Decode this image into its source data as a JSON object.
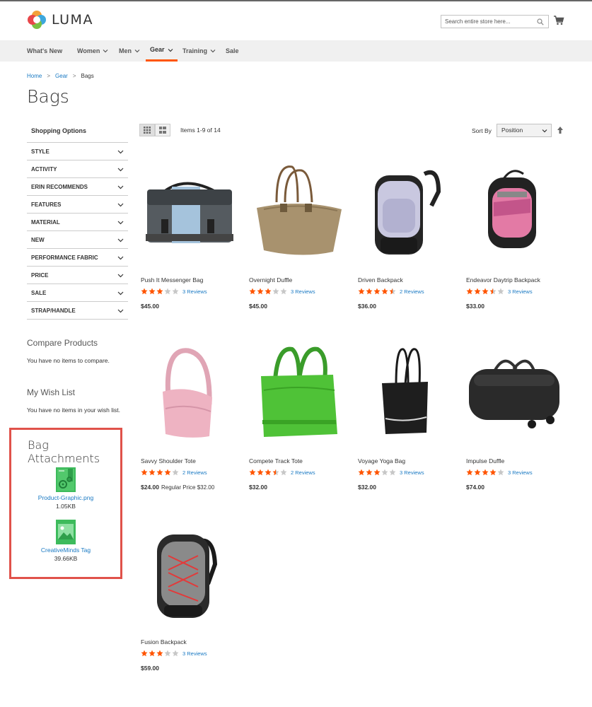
{
  "brand": {
    "name": "LUMA"
  },
  "search": {
    "placeholder": "Search entire store here..."
  },
  "nav": {
    "items": [
      {
        "label": "What's New",
        "dropdown": false,
        "active": false
      },
      {
        "label": "Women",
        "dropdown": true,
        "active": false
      },
      {
        "label": "Men",
        "dropdown": true,
        "active": false
      },
      {
        "label": "Gear",
        "dropdown": true,
        "active": true
      },
      {
        "label": "Training",
        "dropdown": true,
        "active": false
      },
      {
        "label": "Sale",
        "dropdown": false,
        "active": false
      }
    ]
  },
  "breadcrumb": {
    "home": "Home",
    "sep": ">",
    "gear": "Gear",
    "current": "Bags"
  },
  "page": {
    "title": "Bags"
  },
  "sidebar": {
    "shopping_options": "Shopping Options",
    "filters": [
      "Style",
      "Activity",
      "Erin Recommends",
      "Features",
      "Material",
      "New",
      "Performance Fabric",
      "Price",
      "Sale",
      "Strap/Handle"
    ],
    "compare_title": "Compare Products",
    "compare_text": "You have no items to compare.",
    "wishlist_title": "My Wish List",
    "wishlist_text": "You have no items in your wish list."
  },
  "attachments": {
    "title": "Bag Attachments",
    "files": [
      {
        "name": "Product-Graphic.png",
        "size": "1.05KB",
        "icon": "file-graphic-icon"
      },
      {
        "name": "CreativeMinds Tag",
        "size": "39.66KB",
        "icon": "image-file-icon"
      }
    ]
  },
  "toolbar": {
    "items_count": "Items 1-9 of 14",
    "sort_label": "Sort By",
    "sort_value": "Position"
  },
  "colors": {
    "accent": "#ff5501",
    "link": "#1979c3",
    "star": "#ff5501",
    "highlight_border": "#e0524a"
  },
  "products": [
    {
      "name": "Push It Messenger Bag",
      "rating": 3,
      "reviews": "3 Reviews",
      "price": "$45.00"
    },
    {
      "name": "Overnight Duffle",
      "rating": 3,
      "reviews": "3 Reviews",
      "price": "$45.00"
    },
    {
      "name": "Driven Backpack",
      "rating": 4.5,
      "reviews": "2 Reviews",
      "price": "$36.00"
    },
    {
      "name": "Endeavor Daytrip Backpack",
      "rating": 3.5,
      "reviews": "3 Reviews",
      "price": "$33.00"
    },
    {
      "name": "Savvy Shoulder Tote",
      "rating": 4,
      "reviews": "2 Reviews",
      "price": "$24.00",
      "regular_price": "Regular Price $32.00"
    },
    {
      "name": "Compete Track Tote",
      "rating": 3.5,
      "reviews": "2 Reviews",
      "price": "$32.00"
    },
    {
      "name": "Voyage Yoga Bag",
      "rating": 3,
      "reviews": "3 Reviews",
      "price": "$32.00"
    },
    {
      "name": "Impulse Duffle",
      "rating": 4,
      "reviews": "3 Reviews",
      "price": "$74.00"
    },
    {
      "name": "Fusion Backpack",
      "rating": 3,
      "reviews": "3 Reviews",
      "price": "$59.00"
    }
  ]
}
